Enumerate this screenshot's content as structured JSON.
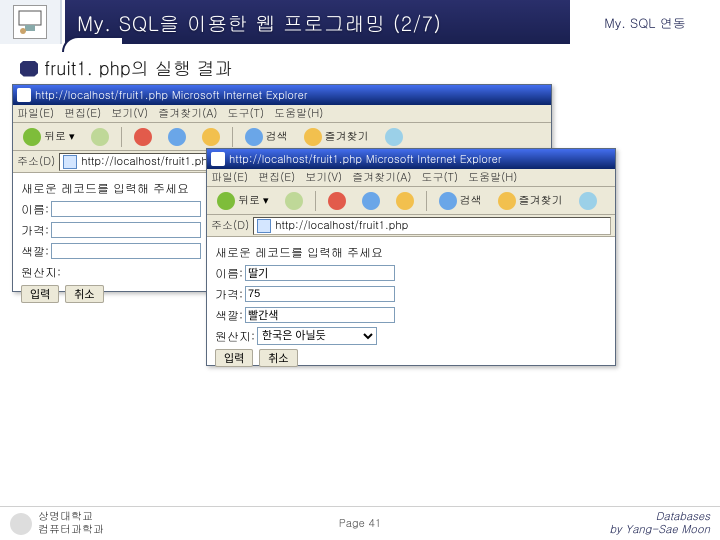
{
  "header": {
    "title": "My. SQL을 이용한 웹 프로그래밍 (2/7)",
    "right": "My. SQL 연동"
  },
  "section_title": "fruit1. php의 실행 결과",
  "browser": {
    "titlebar": "http://localhost/fruit1.php    Microsoft Internet Explorer",
    "menus": [
      "파일(E)",
      "편집(E)",
      "보기(V)",
      "즐겨찾기(A)",
      "도구(T)",
      "도움말(H)"
    ],
    "toolbar": {
      "back": "뒤로",
      "search": "검색",
      "fav": "즐겨찾기"
    },
    "addr_label": "주소(D)",
    "url": "http://localhost/fruit1.php"
  },
  "form": {
    "prompt": "새로운 레코드를 입력해 주세요",
    "labels": {
      "name": "이름:",
      "price": "가격:",
      "color": "색깔:",
      "origin": "원산지:"
    },
    "values": {
      "name": "딸기",
      "price": "75",
      "color": "빨간색",
      "origin": "한국은 아닐듯"
    },
    "origin_options": [
      "한국은 아닐듯"
    ],
    "submit": "입력",
    "cancel": "취소"
  },
  "footer": {
    "org1": "상명대학교",
    "org2": "컴퓨터과학과",
    "page": "Page 41",
    "credit1": "Databases",
    "credit2": "by Yang-Sae Moon"
  },
  "colors": {
    "ie_back": "#7ebd3a",
    "ie_fwd": "#7ebd3a",
    "ie_stop": "#e25b4b",
    "ie_refresh": "#6aa6e8",
    "ie_home": "#f2c04e",
    "ie_search": "#6aa6e8",
    "ie_fav": "#f2c04e"
  }
}
